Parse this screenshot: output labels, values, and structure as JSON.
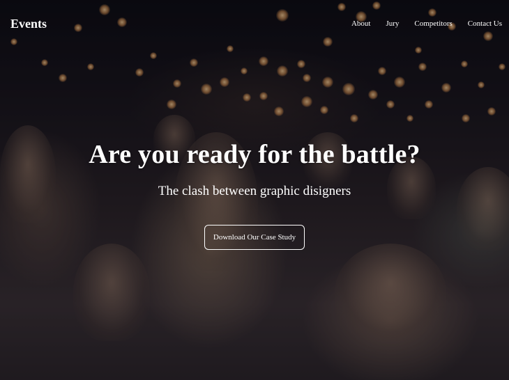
{
  "navbar": {
    "brand": "Events",
    "links": [
      {
        "label": "About"
      },
      {
        "label": "Jury"
      },
      {
        "label": "Competitors"
      },
      {
        "label": "Contact Us"
      }
    ]
  },
  "hero": {
    "headline": "Are you ready for the battle?",
    "subhead": "The clash between graphic disigners",
    "cta_label": "Download Our Case Study"
  },
  "colors": {
    "text": "#ffffff",
    "overlay": "#0a080e",
    "bokeh": "#ffc98a"
  }
}
